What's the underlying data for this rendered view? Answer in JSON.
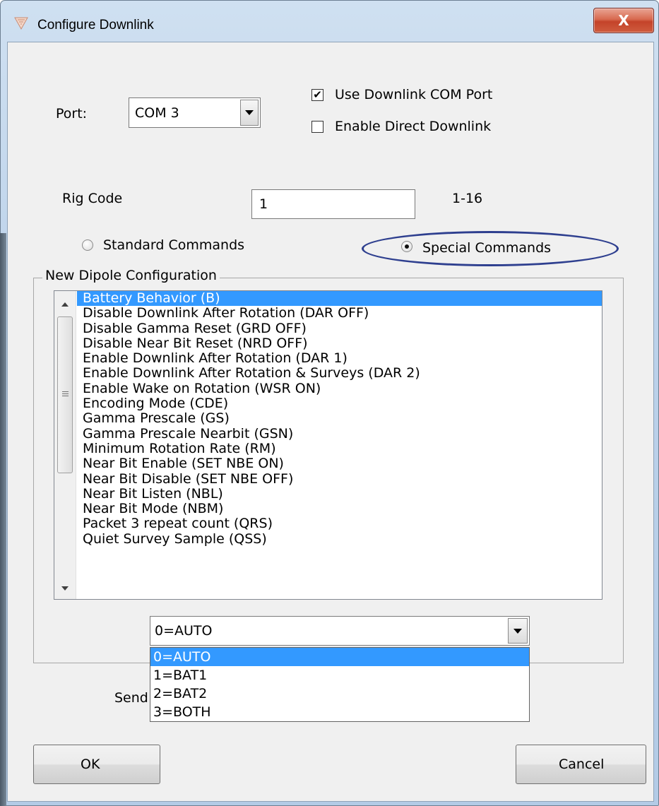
{
  "window": {
    "title": "Configure Downlink",
    "close_glyph": "X"
  },
  "port": {
    "label": "Port:",
    "value": "COM 3"
  },
  "checkboxes": {
    "use_downlink_com_port": {
      "label": "Use Downlink COM Port",
      "checked": true
    },
    "enable_direct_downlink": {
      "label": "Enable Direct Downlink",
      "checked": false
    }
  },
  "rig_code": {
    "label": "Rig Code",
    "value": "1",
    "range": "1-16"
  },
  "radios": {
    "standard": {
      "label": "Standard Commands",
      "selected": false
    },
    "special": {
      "label": "Special Commands",
      "selected": true
    }
  },
  "group": {
    "title": "New Dipole Configuration"
  },
  "command_list": {
    "selected_index": 0,
    "items": [
      "Battery Behavior (B)",
      "Disable Downlink After Rotation (DAR OFF)",
      "Disable Gamma Reset (GRD OFF)",
      "Disable Near Bit Reset (NRD OFF)",
      "Enable Downlink After Rotation (DAR 1)",
      "Enable Downlink After Rotation & Surveys (DAR 2)",
      "Enable Wake on Rotation (WSR ON)",
      "Encoding Mode (CDE)",
      "Gamma Prescale (GS)",
      "Gamma Prescale Nearbit (GSN)",
      "Minimum Rotation Rate (RM)",
      "Near Bit Enable (SET NBE ON)",
      "Near Bit Disable (SET NBE OFF)",
      "Near Bit Listen (NBL)",
      "Near Bit Mode (NBM)",
      "Packet 3 repeat count (QRS)",
      "Quiet Survey Sample (QSS)"
    ]
  },
  "value_combo": {
    "value": "0=AUTO",
    "options": [
      "0=AUTO",
      "1=BAT1",
      "2=BAT2",
      "3=BOTH"
    ],
    "highlighted_index": 0
  },
  "send_label_partial": "Send",
  "buttons": {
    "ok": "OK",
    "cancel": "Cancel"
  },
  "colors": {
    "selection": "#3399ff",
    "annotation_ellipse": "#2e3f8f"
  }
}
